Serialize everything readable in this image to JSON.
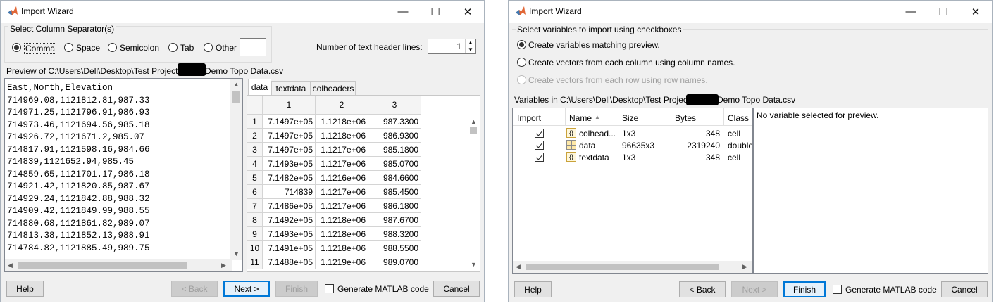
{
  "left_window": {
    "title": "Import Wizard",
    "separator_group_label": "Select Column Separator(s)",
    "separators": [
      {
        "label": "Comma",
        "selected": true
      },
      {
        "label": "Space",
        "selected": false
      },
      {
        "label": "Semicolon",
        "selected": false
      },
      {
        "label": "Tab",
        "selected": false
      },
      {
        "label": "Other",
        "selected": false
      }
    ],
    "header_lines_label": "Number of text header lines:",
    "header_lines_value": "1",
    "preview_label_prefix": "Preview of C:\\Users\\Dell\\Desktop\\Test Project\\",
    "preview_label_suffix": "Demo Topo Data.csv",
    "preview_lines": [
      "East,North,Elevation",
      "714969.08,1121812.81,987.33",
      "714971.25,1121796.91,986.93",
      "714973.46,1121694.56,985.18",
      "714926.72,1121671.2,985.07",
      "714817.91,1121598.16,984.66",
      "714839,1121652.94,985.45",
      "714859.65,1121701.17,986.18",
      "714921.42,1121820.85,987.67",
      "714929.24,1121842.88,988.32",
      "714909.42,1121849.99,988.55",
      "714880.68,1121861.82,989.07",
      "714813.38,1121852.13,988.91",
      "714784.82,1121885.49,989.75"
    ],
    "tabs": [
      "data",
      "textdata",
      "colheaders"
    ],
    "grid_columns": [
      "1",
      "2",
      "3"
    ],
    "grid_rows": [
      {
        "n": "1",
        "c1": "7.1497e+05",
        "c2": "1.1218e+06",
        "c3": "987.3300"
      },
      {
        "n": "2",
        "c1": "7.1497e+05",
        "c2": "1.1218e+06",
        "c3": "986.9300"
      },
      {
        "n": "3",
        "c1": "7.1497e+05",
        "c2": "1.1217e+06",
        "c3": "985.1800"
      },
      {
        "n": "4",
        "c1": "7.1493e+05",
        "c2": "1.1217e+06",
        "c3": "985.0700"
      },
      {
        "n": "5",
        "c1": "7.1482e+05",
        "c2": "1.1216e+06",
        "c3": "984.6600"
      },
      {
        "n": "6",
        "c1": "714839",
        "c2": "1.1217e+06",
        "c3": "985.4500"
      },
      {
        "n": "7",
        "c1": "7.1486e+05",
        "c2": "1.1217e+06",
        "c3": "986.1800"
      },
      {
        "n": "8",
        "c1": "7.1492e+05",
        "c2": "1.1218e+06",
        "c3": "987.6700"
      },
      {
        "n": "9",
        "c1": "7.1493e+05",
        "c2": "1.1218e+06",
        "c3": "988.3200"
      },
      {
        "n": "10",
        "c1": "7.1491e+05",
        "c2": "1.1218e+06",
        "c3": "988.5500"
      },
      {
        "n": "11",
        "c1": "7.1488e+05",
        "c2": "1.1219e+06",
        "c3": "989.0700"
      }
    ],
    "buttons": {
      "help": "Help",
      "back": "< Back",
      "next": "Next >",
      "finish": "Finish",
      "generate": "Generate MATLAB code",
      "cancel": "Cancel"
    }
  },
  "right_window": {
    "title": "Import Wizard",
    "select_label": "Select variables to import using checkboxes",
    "options": [
      {
        "label": "Create variables matching preview.",
        "selected": true,
        "enabled": true
      },
      {
        "label": "Create vectors from each column using column names.",
        "selected": false,
        "enabled": true
      },
      {
        "label": "Create vectors from each row using row names.",
        "selected": false,
        "enabled": false
      }
    ],
    "vars_label_prefix": "Variables in C:\\Users\\Dell\\Desktop\\Test Project\\",
    "vars_label_suffix": "Demo Topo Data.csv",
    "columns": [
      "Import",
      "Name",
      "Size",
      "Bytes",
      "Class"
    ],
    "variables": [
      {
        "name": "colhead...",
        "size": "1x3",
        "bytes": "348",
        "class": "cell",
        "icon": "cell-icon",
        "checked": true
      },
      {
        "name": "data",
        "size": "96635x3",
        "bytes": "2319240",
        "class": "double",
        "icon": "matrix-icon",
        "checked": true
      },
      {
        "name": "textdata",
        "size": "1x3",
        "bytes": "348",
        "class": "cell",
        "icon": "cell-icon",
        "checked": true
      }
    ],
    "preview_text": "No variable selected for preview.",
    "buttons": {
      "help": "Help",
      "back": "< Back",
      "next": "Next >",
      "finish": "Finish",
      "generate": "Generate MATLAB code",
      "cancel": "Cancel"
    }
  },
  "colors": {
    "matlab_orange": "#e16737",
    "focus_blue": "#0078d7"
  }
}
